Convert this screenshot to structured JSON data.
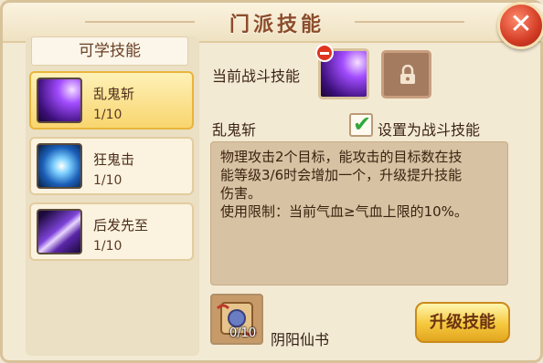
{
  "window": {
    "title": "门派技能"
  },
  "sidebar": {
    "header": "可学技能",
    "skills": [
      {
        "name": "乱鬼斩",
        "level": "1/10",
        "icon": "purple-slash-skill-icon",
        "selected": true
      },
      {
        "name": "狂鬼击",
        "level": "1/10",
        "icon": "blue-ghost-strike-skill-icon",
        "selected": false
      },
      {
        "name": "后发先至",
        "level": "1/10",
        "icon": "violet-blade-skill-icon",
        "selected": false
      }
    ]
  },
  "detail": {
    "current_label": "当前战斗技能",
    "skill_name": "乱鬼斩",
    "set_battle_label": "设置为战斗技能",
    "set_battle_checked": true,
    "description": "物理攻击2个目标，能攻击的目标数在技\n能等级3/6时会增加一个，升级提升技能\n伤害。",
    "limit": "使用限制：当前气血≥气血上限的10%。"
  },
  "item": {
    "name": "阴阳仙书",
    "count": "0/10",
    "icon": "scroll-book-icon"
  },
  "buttons": {
    "upgrade": "升级技能",
    "close_icon": "close-icon"
  },
  "colors": {
    "selected_bg": "#f8d56e",
    "panel_bg": "#f3ead4",
    "accent_red": "#d33c25"
  }
}
